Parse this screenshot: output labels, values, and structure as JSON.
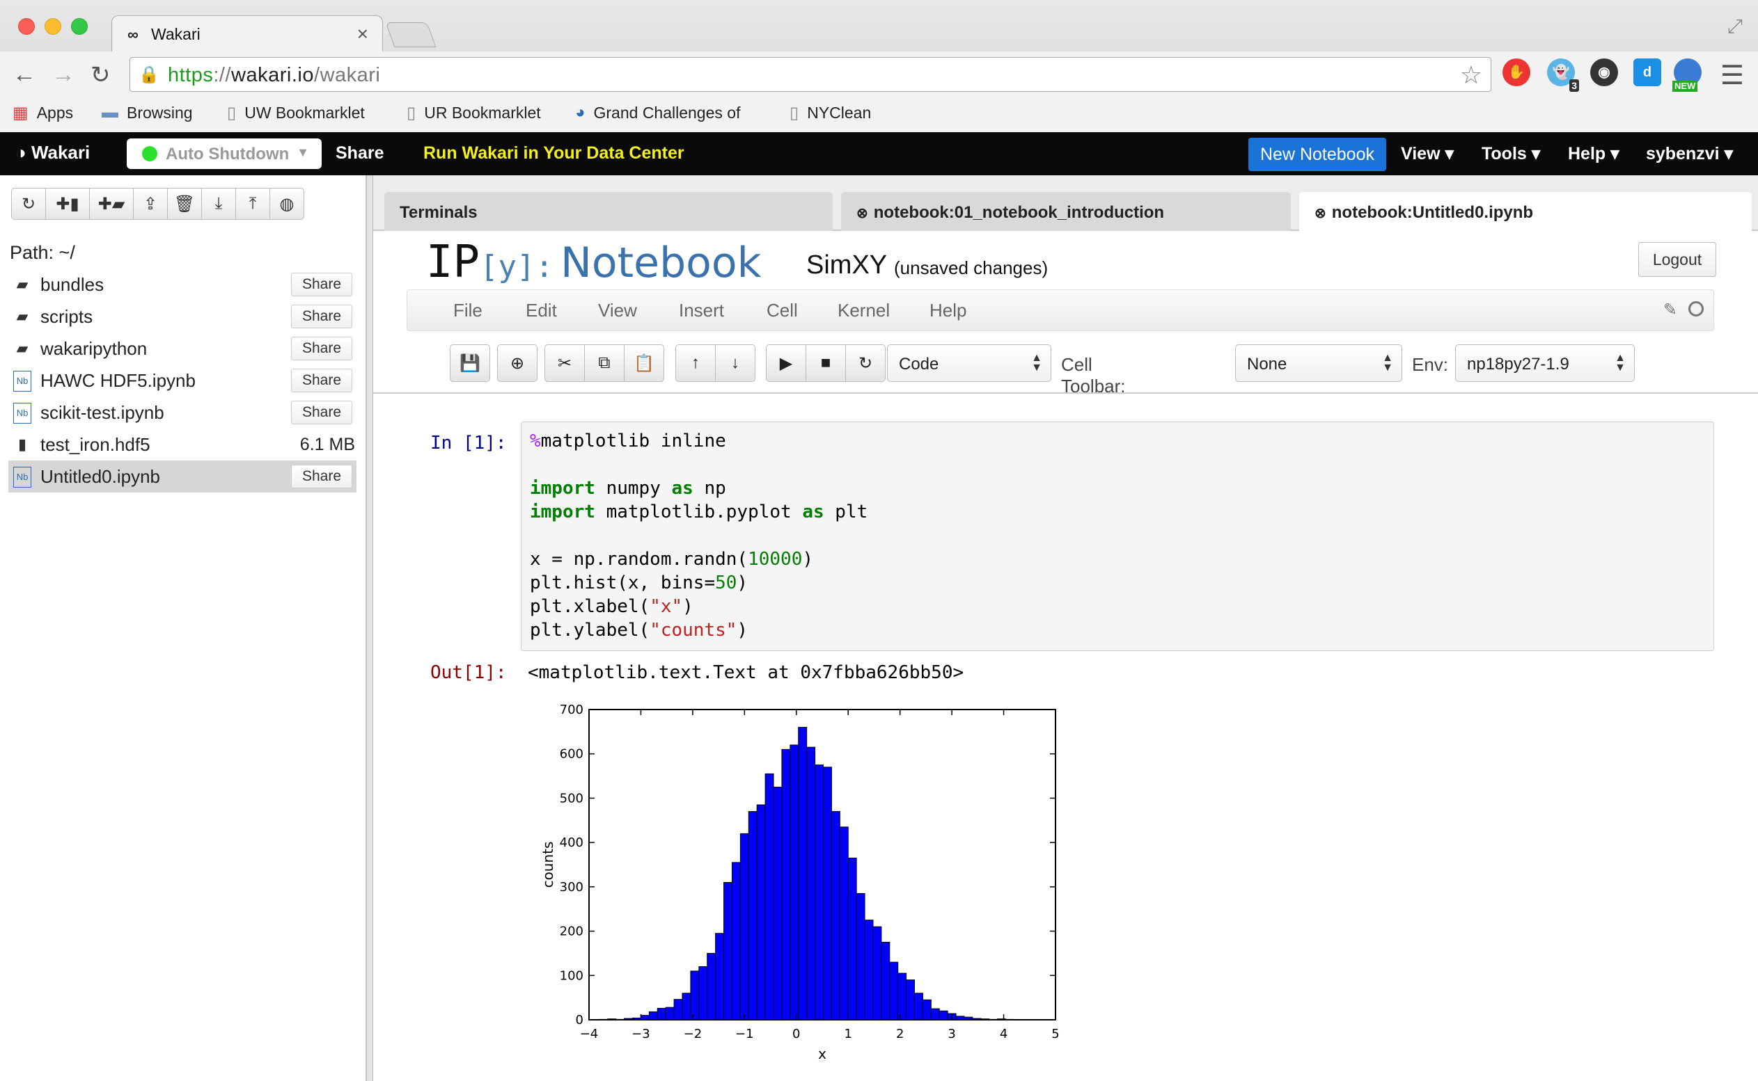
{
  "browser": {
    "tab_title": "Wakari",
    "tab_favicon": "∞",
    "url_scheme": "https",
    "url_sep": "://",
    "url_host": "wakari.io",
    "url_path": "/wakari",
    "extension_badge": "3",
    "extension_new": "NEW",
    "bookmarks": [
      "Apps",
      "Browsing",
      "UW Bookmarklet",
      "UR Bookmarklet",
      "Grand Challenges of",
      "NYClean"
    ]
  },
  "appbar": {
    "brand": "Wakari",
    "auto_shutdown": "Auto Shutdown",
    "share": "Share",
    "run_dc": "Run Wakari in Your Data Center",
    "new_notebook": "New Notebook",
    "view": "View",
    "tools": "Tools",
    "help": "Help",
    "user": "sybenzvi",
    "caret": "▾",
    "accent": "#f5f01a",
    "button_color": "#1a73d6"
  },
  "sidebar": {
    "path_label": "Path: ~/",
    "files": [
      {
        "name": "bundles",
        "type": "folder",
        "share": "Share"
      },
      {
        "name": "scripts",
        "type": "folder",
        "share": "Share"
      },
      {
        "name": "wakaripython",
        "type": "folder",
        "share": "Share"
      },
      {
        "name": "HAWC HDF5.ipynb",
        "type": "notebook",
        "share": "Share"
      },
      {
        "name": "scikit-test.ipynb",
        "type": "notebook",
        "share": "Share"
      },
      {
        "name": "test_iron.hdf5",
        "type": "file",
        "size": "6.1 MB"
      },
      {
        "name": "Untitled0.ipynb",
        "type": "notebook",
        "share": "Share"
      }
    ],
    "nb_icon_text": "Nb"
  },
  "tabs": [
    {
      "label": "Terminals"
    },
    {
      "label": "notebook:01_notebook_introduction"
    },
    {
      "label": "notebook:Untitled0.ipynb"
    }
  ],
  "notebook": {
    "logo_ip": "IP",
    "logo_y": "[y]:",
    "logo_nb": "Notebook",
    "name": "SimXY",
    "status": "(unsaved changes)",
    "logout": "Logout",
    "menu": [
      "File",
      "Edit",
      "View",
      "Insert",
      "Cell",
      "Kernel",
      "Help"
    ],
    "cell_type": "Code",
    "cell_toolbar_label": "Cell Toolbar:",
    "cell_toolbar_value": "None",
    "env_label": "Env:",
    "env_value": "np18py27-1.9",
    "in_prompt": "In [1]:",
    "out_prompt": "Out[1]:",
    "output_text": "<matplotlib.text.Text at 0x7fbba626bb50>",
    "code": {
      "l1_pct": "%",
      "l1_rest": "matplotlib inline",
      "kw_import": "import",
      "kw_as": "as",
      "l3_mod": " numpy ",
      "l3_alias": " np",
      "l4_mod": " matplotlib.pyplot ",
      "l4_alias": " plt",
      "l6_a": "x = np.random.randn(",
      "l6_num": "10000",
      "l6_b": ")",
      "l7_a": "plt.hist(x, bins=",
      "l7_num": "50",
      "l7_b": ")",
      "l8_a": "plt.xlabel(",
      "l8_str": "\"x\"",
      "l8_b": ")",
      "l9_a": "plt.ylabel(",
      "l9_str": "\"counts\"",
      "l9_b": ")"
    }
  },
  "chart_data": {
    "type": "bar",
    "xlabel": "x",
    "ylabel": "counts",
    "xlim": [
      -4,
      5
    ],
    "ylim": [
      0,
      700
    ],
    "xticks": [
      -4,
      -3,
      -2,
      -1,
      0,
      1,
      2,
      3,
      4,
      5
    ],
    "yticks": [
      0,
      100,
      200,
      300,
      400,
      500,
      600,
      700
    ],
    "bar_color": "#0000ff",
    "bins": [
      {
        "x0": -3.8,
        "x1": -3.64,
        "count": 1
      },
      {
        "x0": -3.64,
        "x1": -3.48,
        "count": 2
      },
      {
        "x0": -3.48,
        "x1": -3.32,
        "count": 1
      },
      {
        "x0": -3.32,
        "x1": -3.16,
        "count": 3
      },
      {
        "x0": -3.16,
        "x1": -3.0,
        "count": 4
      },
      {
        "x0": -3.0,
        "x1": -2.84,
        "count": 10
      },
      {
        "x0": -2.84,
        "x1": -2.68,
        "count": 18
      },
      {
        "x0": -2.68,
        "x1": -2.52,
        "count": 26
      },
      {
        "x0": -2.52,
        "x1": -2.36,
        "count": 28
      },
      {
        "x0": -2.36,
        "x1": -2.2,
        "count": 46
      },
      {
        "x0": -2.2,
        "x1": -2.04,
        "count": 60
      },
      {
        "x0": -2.04,
        "x1": -1.88,
        "count": 110
      },
      {
        "x0": -1.88,
        "x1": -1.72,
        "count": 120
      },
      {
        "x0": -1.72,
        "x1": -1.56,
        "count": 150
      },
      {
        "x0": -1.56,
        "x1": -1.4,
        "count": 195
      },
      {
        "x0": -1.4,
        "x1": -1.24,
        "count": 310
      },
      {
        "x0": -1.24,
        "x1": -1.08,
        "count": 355
      },
      {
        "x0": -1.08,
        "x1": -0.92,
        "count": 420
      },
      {
        "x0": -0.92,
        "x1": -0.76,
        "count": 470
      },
      {
        "x0": -0.76,
        "x1": -0.6,
        "count": 485
      },
      {
        "x0": -0.6,
        "x1": -0.44,
        "count": 555
      },
      {
        "x0": -0.44,
        "x1": -0.28,
        "count": 525
      },
      {
        "x0": -0.28,
        "x1": -0.12,
        "count": 610
      },
      {
        "x0": -0.12,
        "x1": 0.04,
        "count": 620
      },
      {
        "x0": 0.04,
        "x1": 0.2,
        "count": 660
      },
      {
        "x0": 0.2,
        "x1": 0.36,
        "count": 615
      },
      {
        "x0": 0.36,
        "x1": 0.52,
        "count": 575
      },
      {
        "x0": 0.52,
        "x1": 0.68,
        "count": 570
      },
      {
        "x0": 0.68,
        "x1": 0.84,
        "count": 470
      },
      {
        "x0": 0.84,
        "x1": 1.0,
        "count": 435
      },
      {
        "x0": 1.0,
        "x1": 1.16,
        "count": 365
      },
      {
        "x0": 1.16,
        "x1": 1.32,
        "count": 285
      },
      {
        "x0": 1.32,
        "x1": 1.48,
        "count": 225
      },
      {
        "x0": 1.48,
        "x1": 1.64,
        "count": 210
      },
      {
        "x0": 1.64,
        "x1": 1.8,
        "count": 175
      },
      {
        "x0": 1.8,
        "x1": 1.96,
        "count": 130
      },
      {
        "x0": 1.96,
        "x1": 2.12,
        "count": 105
      },
      {
        "x0": 2.12,
        "x1": 2.28,
        "count": 90
      },
      {
        "x0": 2.28,
        "x1": 2.44,
        "count": 60
      },
      {
        "x0": 2.44,
        "x1": 2.6,
        "count": 45
      },
      {
        "x0": 2.6,
        "x1": 2.76,
        "count": 25
      },
      {
        "x0": 2.76,
        "x1": 2.92,
        "count": 20
      },
      {
        "x0": 2.92,
        "x1": 3.08,
        "count": 14
      },
      {
        "x0": 3.08,
        "x1": 3.24,
        "count": 8
      },
      {
        "x0": 3.24,
        "x1": 3.4,
        "count": 6
      },
      {
        "x0": 3.4,
        "x1": 3.56,
        "count": 3
      },
      {
        "x0": 3.56,
        "x1": 3.72,
        "count": 2
      },
      {
        "x0": 3.72,
        "x1": 3.88,
        "count": 1
      },
      {
        "x0": 3.88,
        "x1": 4.04,
        "count": 2
      },
      {
        "x0": 4.04,
        "x1": 4.2,
        "count": 1
      }
    ]
  }
}
